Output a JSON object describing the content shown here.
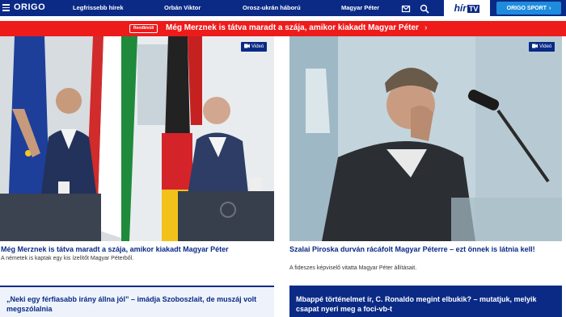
{
  "header": {
    "logo": "ORIGO",
    "nav": [
      "Legfrissebb hírek",
      "Orbán Viktor",
      "Orosz-ukrán háború",
      "Magyar Péter"
    ],
    "hirtv_text": "hír",
    "hirtv_tv": "TV",
    "sport_label": "ORIGO SPORT"
  },
  "breaking": {
    "badge": "Rendkívüli",
    "text": "Még Merznek is tátva maradt a szája, amikor kiakadt Magyar Péter"
  },
  "cards": [
    {
      "badge": "Videó",
      "title": "Még Merznek is tátva maradt a szája, amikor kiakadt Magyar Péter",
      "lead": "A németek is kaptak egy kis ízelítőt Magyar Péterből."
    },
    {
      "badge": "Videó",
      "title": "Szalai Piroska durván rácáfolt Magyar Péterre – ezt önnek is látnia kell!",
      "lead": "A fideszes képviselő vitatta Magyar Péter állításait."
    }
  ],
  "bottom": [
    {
      "title": "„Neki egy férfiasabb irány állna jól” – imádja Szoboszlait, de muszáj volt megszólalnia"
    },
    {
      "title": "Mbappé történelmet ír, C. Ronaldo megint elbukik? – mutatjuk, melyik csapat nyeri meg a foci-vb-t"
    }
  ],
  "colors": {
    "brand": "#0a2a86",
    "breaking": "#ee1b1b",
    "sport": "#1f8bdc"
  }
}
